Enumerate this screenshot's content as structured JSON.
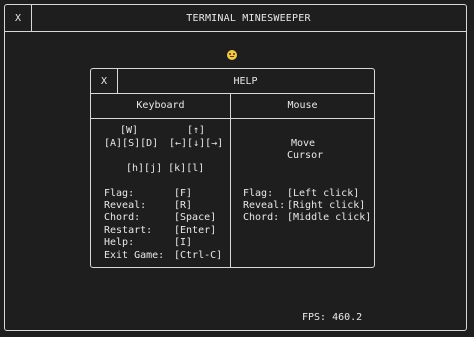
{
  "window": {
    "close_label": "X",
    "title": "TERMINAL MINESWEEPER"
  },
  "status": {
    "face_icon": "smiley-face-icon"
  },
  "help_dialog": {
    "close_label": "X",
    "title": "HELP",
    "keyboard_header": "Keyboard",
    "mouse_header": "Mouse",
    "wasd": {
      "up": "[W]",
      "row": "[A][S][D]"
    },
    "arrows": {
      "up": "[↑]",
      "row": "[←][↓][→]"
    },
    "vim_keys": "[h][j] [k][l]",
    "keyboard_bindings": [
      {
        "action": "Flag:",
        "key": "[F]"
      },
      {
        "action": "Reveal:",
        "key": "[R]"
      },
      {
        "action": "Chord:",
        "key": "[Space]"
      },
      {
        "action": "Restart:",
        "key": "[Enter]"
      },
      {
        "action": "Help:",
        "key": "[I]"
      },
      {
        "action": "Exit Game:",
        "key": "[Ctrl-C]"
      }
    ],
    "mouse_move": {
      "line1": "Move",
      "line2": "Cursor"
    },
    "mouse_bindings": [
      {
        "action": "Flag:",
        "key": "[Left click]"
      },
      {
        "action": "Reveal:",
        "key": "[Right click]"
      },
      {
        "action": "Chord:",
        "key": "[Middle click]"
      }
    ]
  },
  "footer": {
    "fps": "FPS: 460.2"
  }
}
